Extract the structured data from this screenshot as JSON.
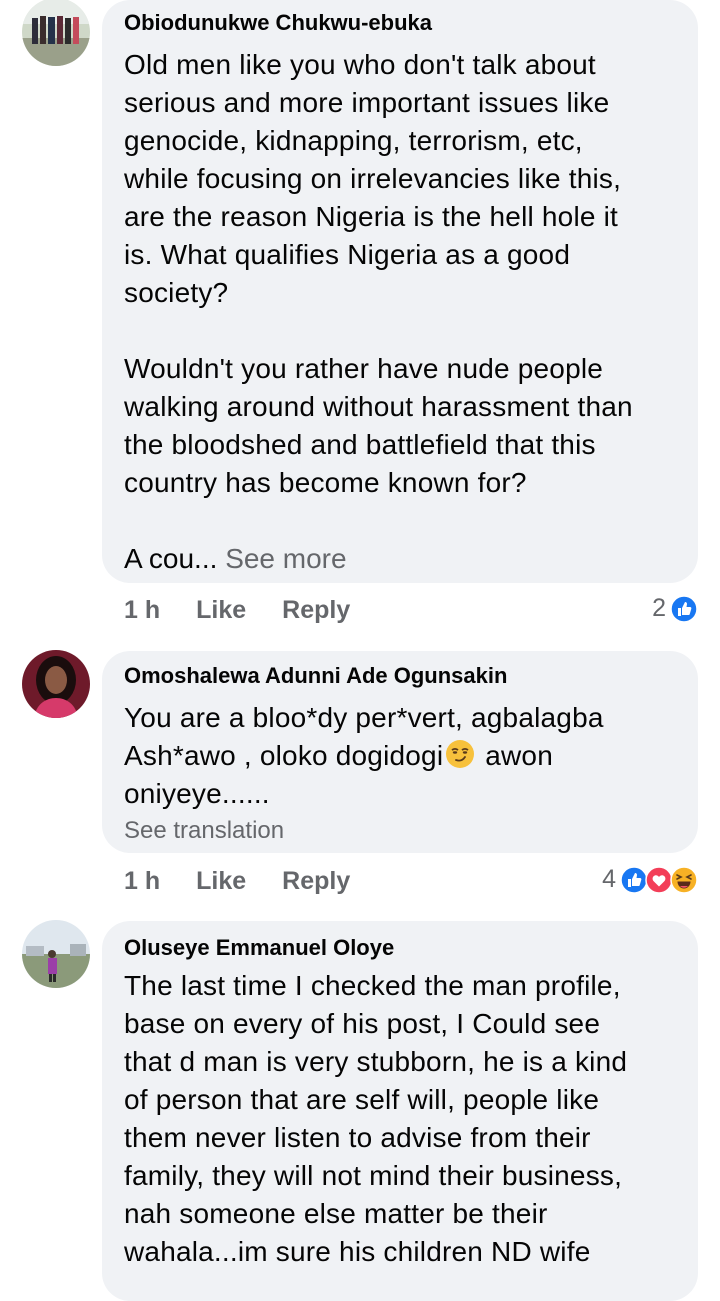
{
  "colors": {
    "bubble_bg": "#f0f2f5",
    "secondary_text": "#65676b",
    "like_blue": "#1877f2",
    "love_red": "#f33e58",
    "haha_yellow": "#f7b125"
  },
  "comments": [
    {
      "author": "Obiodunukwe Chukwu-ebuka",
      "text": "Old men like you who don't talk about\nserious and more important issues like\ngenocide, kidnapping, terrorism, etc,\nwhile focusing on irrelevancies like this,\nare the reason Nigeria is the hell hole it\nis. What qualifies Nigeria as a good\nsociety?\n\nWouldn't you rather have nude people\nwalking around without harassment than\nthe bloodshed and battlefield that this\ncountry has become known for?",
      "truncated_text": "A cou...",
      "see_more": "See more",
      "time": "1 h",
      "like_label": "Like",
      "reply_label": "Reply",
      "reaction_count": "2",
      "reaction_icons": [
        "like-icon"
      ]
    },
    {
      "author": "Omoshalewa Adunni Ade Ogunsakin",
      "text_part1": "You are a bloo*dy per*vert, agbalagba\nAsh*awo , oloko dogidogi",
      "emoji": "smirk-emoji",
      "text_part2": " awon\noniyeye......",
      "see_translation": "See translation",
      "time": "1 h",
      "like_label": "Like",
      "reply_label": "Reply",
      "reaction_count": "4",
      "reaction_icons": [
        "like-icon",
        "love-icon",
        "haha-icon"
      ]
    },
    {
      "author": "Oluseye Emmanuel Oloye",
      "text": "The last time I checked the man profile,\nbase on every of his post,  I Could see\nthat d man is very stubborn, he is a kind\nof person that are self will, people like\nthem never listen to advise from their\nfamily, they will not mind their business,\nnah someone else  matter be their\nwahala...im sure his children ND wife"
    }
  ]
}
